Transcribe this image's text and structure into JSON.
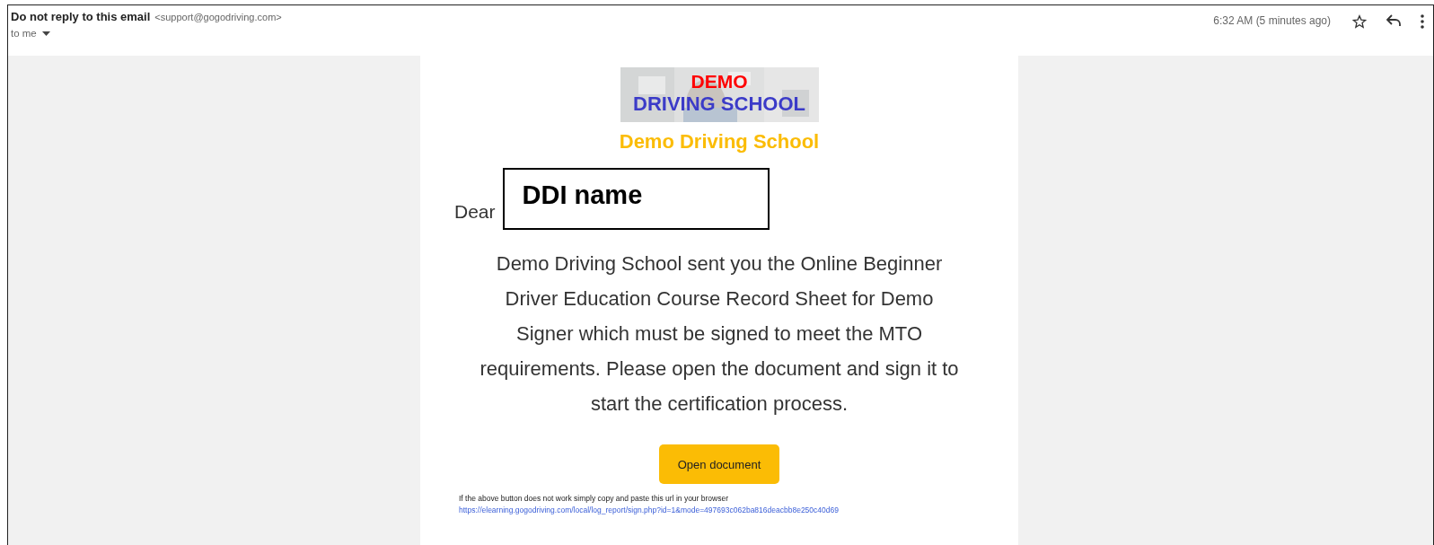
{
  "header": {
    "sender_name": "Do not reply to this email",
    "sender_email": "<support@gogodriving.com>",
    "recipient": "to me",
    "time": "6:32 AM (5 minutes ago)",
    "starred": false
  },
  "email": {
    "logo": {
      "kind": "picture",
      "line_1": "DEMO",
      "line_2": "DRIVING SCHOOL"
    },
    "school_name": "Demo Driving School",
    "greeting": "Dear",
    "name_field": "DDI name",
    "message": "Demo Driving School sent you the Online Beginner Driver Education Course Record Sheet for Demo Signer which must be signed to meet the MTO requirements. Please open the document and sign it to start the certification process.",
    "button": "Open document",
    "footer_text": "If the above button does not work simply copy and paste this url in your browser",
    "footer_link": "https://elearning.gogodriving.com/local/log_report/sign.php?id=1&mode=497693c062ba816deacbb8e250c40d69"
  }
}
